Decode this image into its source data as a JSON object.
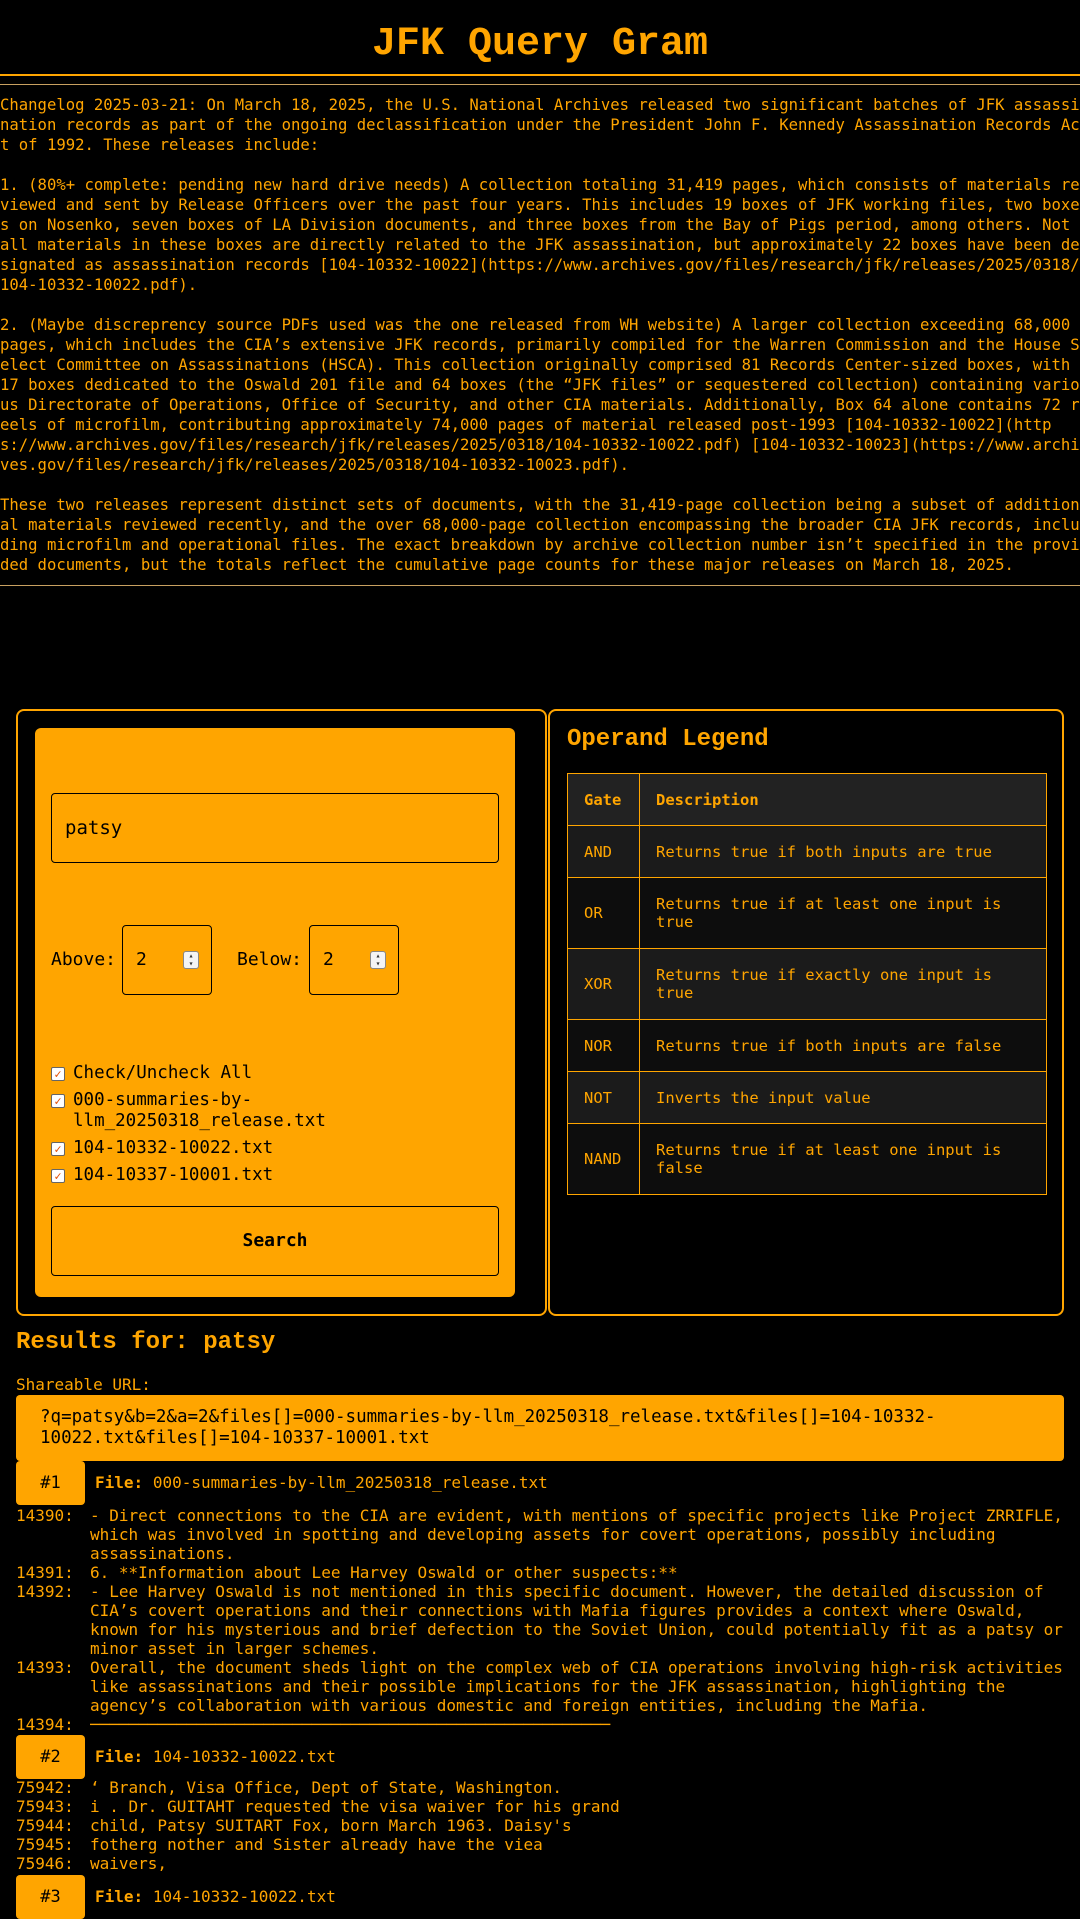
{
  "header": {
    "title": "JFK Query Gram"
  },
  "changelog": "Changelog 2025-03-21: On March 18, 2025, the U.S. National Archives released two significant batches of JFK assassination records as part of the ongoing declassification under the President John F. Kennedy Assassination Records Act of 1992. These releases include:\n\n1. (80%+ complete: pending new hard drive needs) A collection totaling 31,419 pages, which consists of materials reviewed and sent by Release Officers over the past four years. This includes 19 boxes of JFK working files, two boxes on Nosenko, seven boxes of LA Division documents, and three boxes from the Bay of Pigs period, among others. Not all materials in these boxes are directly related to the JFK assassination, but approximately 22 boxes have been designated as assassination records [104-10332-10022](https://www.archives.gov/files/research/jfk/releases/2025/0318/104-10332-10022.pdf).\n\n2. (Maybe discreprency source PDFs used was the one released from WH website) A larger collection exceeding 68,000 pages, which includes the CIA’s extensive JFK records, primarily compiled for the Warren Commission and the House Select Committee on Assassinations (HSCA). This collection originally comprised 81 Records Center-sized boxes, with 17 boxes dedicated to the Oswald 201 file and 64 boxes (the “JFK files” or sequestered collection) containing various Directorate of Operations, Office of Security, and other CIA materials. Additionally, Box 64 alone contains 72 reels of microfilm, contributing approximately 74,000 pages of material released post-1993 [104-10332-10022](https://www.archives.gov/files/research/jfk/releases/2025/0318/104-10332-10022.pdf) [104-10332-10023](https://www.archives.gov/files/research/jfk/releases/2025/0318/104-10332-10023.pdf).\n\nThese two releases represent distinct sets of documents, with the 31,419-page collection being a subset of additional materials reviewed recently, and the over 68,000-page collection encompassing the broader CIA JFK records, including microfilm and operational files. The exact breakdown by archive collection number isn’t specified in the provided documents, but the totals reflect the cumulative page counts for these major releases on March 18, 2025.",
  "form": {
    "query_value": "patsy",
    "above_label": "Above:",
    "above_value": "2",
    "below_label": "Below:",
    "below_value": "2",
    "check_all_label": "Check/Uncheck All",
    "files": [
      {
        "label": "000-summaries-by-llm_20250318_release.txt",
        "checked": true
      },
      {
        "label": "104-10332-10022.txt",
        "checked": true
      },
      {
        "label": "104-10337-10001.txt",
        "checked": true
      }
    ],
    "search_label": "Search"
  },
  "legend": {
    "title": "Operand Legend",
    "headers": [
      "Gate",
      "Description"
    ],
    "rows": [
      {
        "gate": "AND",
        "description": "Returns true if both inputs are true"
      },
      {
        "gate": "OR",
        "description": "Returns true if at least one input is true"
      },
      {
        "gate": "XOR",
        "description": "Returns true if exactly one input is true"
      },
      {
        "gate": "NOR",
        "description": "Returns true if both inputs are false"
      },
      {
        "gate": "NOT",
        "description": "Inverts the input value"
      },
      {
        "gate": "NAND",
        "description": "Returns true if at least one input is false"
      }
    ]
  },
  "results": {
    "title": "Results for: patsy",
    "share_label": "Shareable URL:",
    "share_url": "?q=patsy&b=2&a=2&files[]=000-summaries-by-llm_20250318_release.txt&files[]=104-10332-10022.txt&files[]=104-10337-10001.txt",
    "file_prefix": "File:",
    "items": [
      {
        "badge": "#1",
        "file": "000-summaries-by-llm_20250318_release.txt",
        "lines": [
          {
            "n": "14390:",
            "t": "  - Direct connections to the CIA are evident, with mentions of specific projects like Project ZRRIFLE, which was involved in spotting and developing assets for covert operations, possibly including assassinations."
          },
          {
            "n": "14391:",
            "t": "6. **Information about Lee Harvey Oswald or other suspects:**"
          },
          {
            "n": "14392:",
            "t": "  - Lee Harvey Oswald is not mentioned in this specific document. However, the detailed discussion of CIA’s covert operations and their connections with Mafia figures provides a context where Oswald, known for his mysterious and brief defection to the Soviet Union, could potentially fit as a patsy or minor asset in larger schemes."
          },
          {
            "n": "14393:",
            "t": "Overall, the document sheds light on the complex web of CIA operations involving high-risk activities like assassinations and their possible implications for the JFK assassination, highlighting the agency’s collaboration with various domestic and foreign entities, including the Mafia."
          },
          {
            "n": "14394:",
            "t": "──────────────────────────────────────────────────────"
          }
        ]
      },
      {
        "badge": "#2",
        "file": "104-10332-10022.txt",
        "lines": [
          {
            "n": "75942:",
            "t": "‘ Branch, Visa Office, Dept of State, Washington."
          },
          {
            "n": "75943:",
            "t": "i . Dr. GUITAHT requested the visa waiver for his grand"
          },
          {
            "n": "75944:",
            "t": "child, Patsy SUITART Fox, born March 1963. Daisy's"
          },
          {
            "n": "75945:",
            "t": "fotherg nother and Sister already have the viea"
          },
          {
            "n": "75946:",
            "t": "waivers,"
          }
        ]
      },
      {
        "badge": "#3",
        "file": "104-10332-10022.txt",
        "lines": []
      }
    ]
  }
}
